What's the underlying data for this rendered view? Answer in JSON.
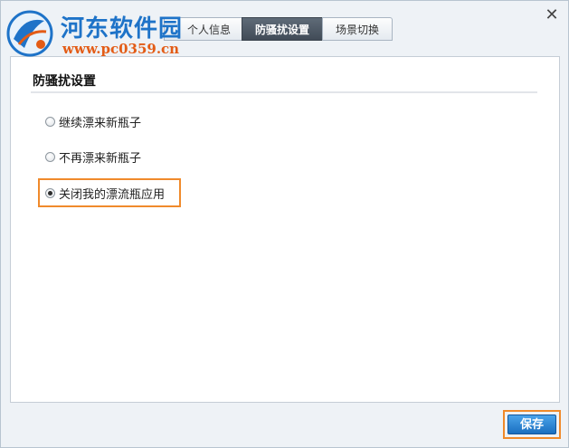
{
  "watermark": {
    "site_name": "河东软件园",
    "site_url": "www.pc0359.cn"
  },
  "tabs": [
    {
      "label": "个人信息",
      "active": false
    },
    {
      "label": "防骚扰设置",
      "active": true
    },
    {
      "label": "场景切换",
      "active": false
    }
  ],
  "section": {
    "title": "防骚扰设置"
  },
  "options": [
    {
      "label": "继续漂来新瓶子",
      "checked": false
    },
    {
      "label": "不再漂来新瓶子",
      "checked": false
    },
    {
      "label": "关闭我的漂流瓶应用",
      "checked": true
    }
  ],
  "footer": {
    "save_label": "保存"
  },
  "colors": {
    "accent_highlight": "#f08a2b",
    "save_button": "#1a6fc0",
    "active_tab": "#4a5460",
    "watermark_blue": "#1e73c8",
    "watermark_orange": "#e35c16"
  },
  "icons": {
    "close": "close-icon",
    "logo": "site-logo-icon"
  }
}
